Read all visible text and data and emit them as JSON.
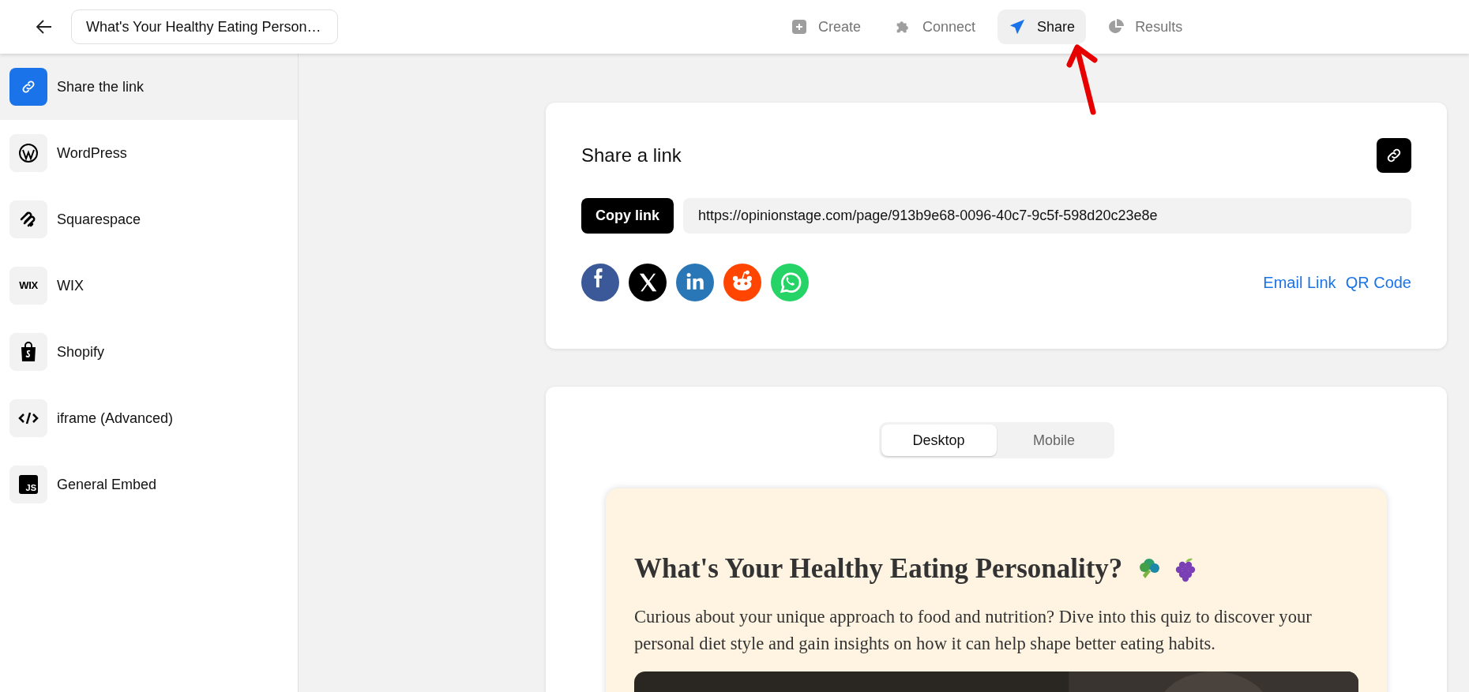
{
  "header": {
    "title_field": "What's Your Healthy Eating Person…",
    "nav": [
      {
        "label": "Create",
        "kind": "create",
        "selected": false
      },
      {
        "label": "Connect",
        "kind": "connect",
        "selected": false
      },
      {
        "label": "Share",
        "kind": "share",
        "selected": true
      },
      {
        "label": "Results",
        "kind": "results",
        "selected": false
      }
    ]
  },
  "sidebar": {
    "items": [
      {
        "label": "Share the link",
        "kind": "link",
        "selected": true
      },
      {
        "label": "WordPress",
        "kind": "wordpress",
        "selected": false
      },
      {
        "label": "Squarespace",
        "kind": "squarespace",
        "selected": false
      },
      {
        "label": "WIX",
        "kind": "wix",
        "icon_text": "WIX",
        "selected": false
      },
      {
        "label": "Shopify",
        "kind": "shopify",
        "selected": false
      },
      {
        "label": "iframe (Advanced)",
        "kind": "code",
        "selected": false
      },
      {
        "label": "General Embed",
        "kind": "js",
        "icon_text": "JS",
        "selected": false
      }
    ]
  },
  "share_card": {
    "title": "Share a link",
    "copy_button": "Copy link",
    "url": "https://opinionstage.com/page/913b9e68-0096-40c7-9c5f-598d20c23e8e",
    "social": [
      {
        "kind": "facebook",
        "color": "#3b5998"
      },
      {
        "kind": "x",
        "color": "#000000"
      },
      {
        "kind": "linkedin",
        "color": "#2a77b8"
      },
      {
        "kind": "reddit",
        "color": "#ff4500"
      },
      {
        "kind": "whatsapp",
        "color": "#25d366"
      }
    ],
    "links": [
      "Email Link",
      "QR Code"
    ]
  },
  "preview": {
    "toggle": [
      {
        "label": "Desktop",
        "selected": true
      },
      {
        "label": "Mobile",
        "selected": false
      }
    ],
    "quiz_title": "What's Your Healthy Eating Personality?",
    "quiz_description": "Curious about your unique approach to food and nutrition? Dive into this quiz to discover your personal diet style and gain insights on how it can help shape better eating habits."
  }
}
